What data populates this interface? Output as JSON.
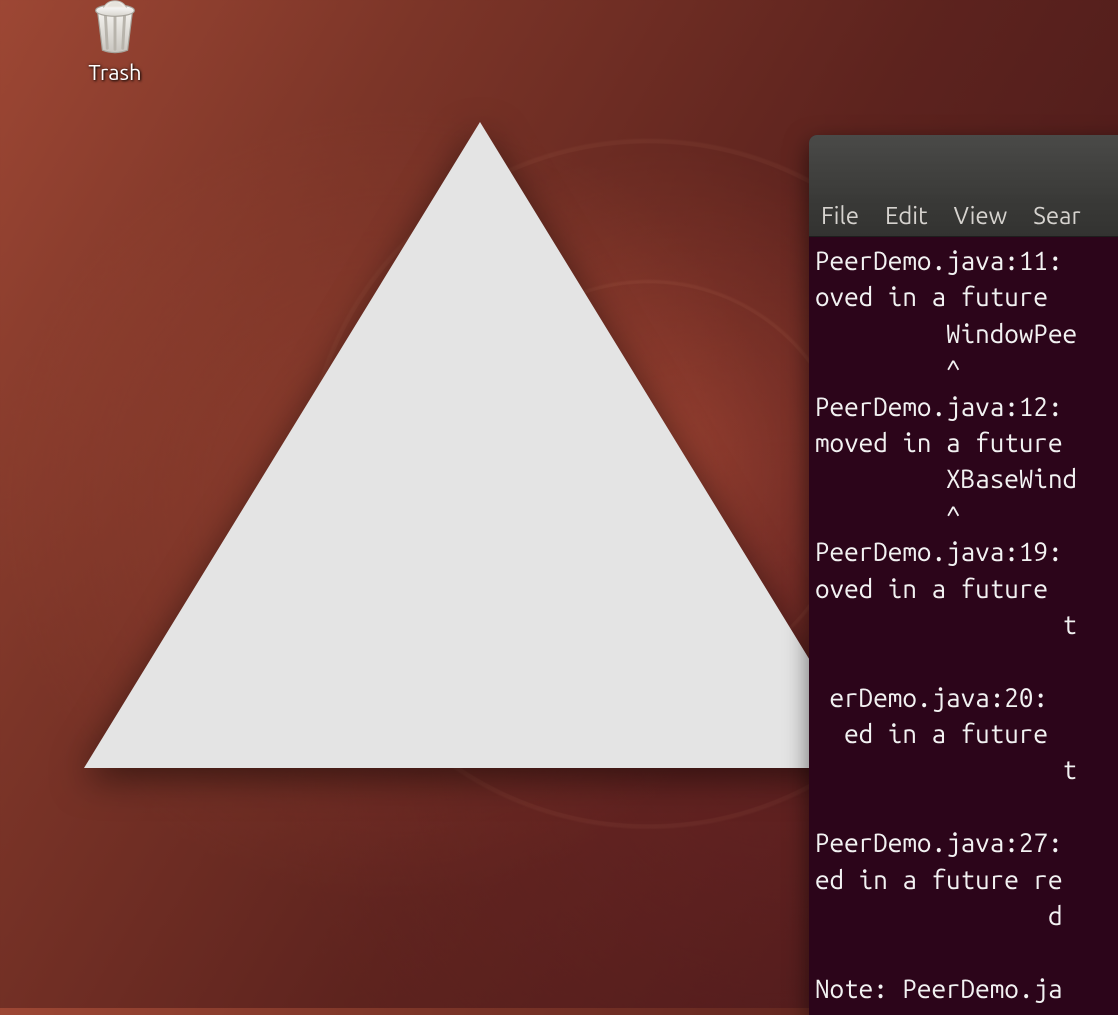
{
  "desktop": {
    "trash": {
      "label": "Trash",
      "icon": "trash-icon"
    }
  },
  "triangle_window": {
    "fill": "#e4e4e4"
  },
  "terminal": {
    "menus": {
      "file": "File",
      "edit": "Edit",
      "view": "View",
      "search": "Sear"
    },
    "output": "PeerDemo.java:11:\noved in a future \n         WindowPee\n         ^\nPeerDemo.java:12:\nmoved in a future\n         XBaseWind\n         ^\nPeerDemo.java:19:\noved in a future \n                 t\n\n erDemo.java:20:\n  ed in a future\n                 t\n\nPeerDemo.java:27:\ned in a future re\n                d\n\nNote: PeerDemo.ja"
  }
}
